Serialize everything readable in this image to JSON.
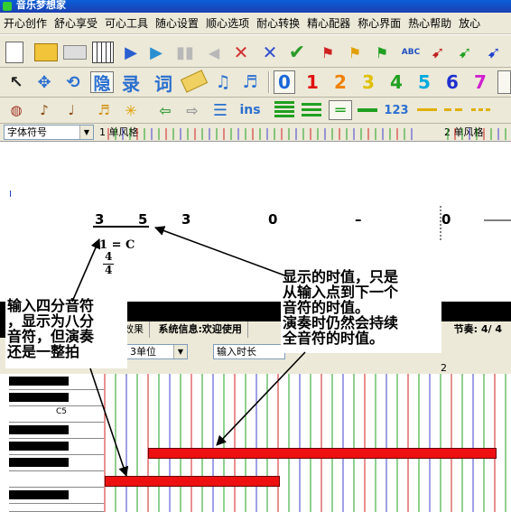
{
  "window": {
    "title": "音乐梦想家"
  },
  "menu": [
    "开心创作",
    "舒心享受",
    "可心工具",
    "随心设置",
    "顺心选项",
    "耐心转换",
    "精心配器",
    "称心界面",
    "热心帮助",
    "放心"
  ],
  "toolbar2": {
    "hide_label": "隐",
    "record_label": "录",
    "lyric_label": "词",
    "numbers": [
      "0",
      "1",
      "2",
      "3",
      "4",
      "5",
      "6",
      "7"
    ],
    "number_colors": [
      "#1a66d8",
      "#e01010",
      "#f08000",
      "#e0c000",
      "#20a020",
      "#00aadd",
      "#2030d0",
      "#d020d0"
    ]
  },
  "toolbar3": {
    "ins_label": "ins",
    "num123_label": "123"
  },
  "selector": {
    "font_combo": "字体符号",
    "staff1_label": "1 单风格",
    "staff2_label": "2 单风格"
  },
  "score": {
    "cursor_mark": "I",
    "notes": [
      "3",
      "5",
      "3",
      "0",
      "–",
      "0"
    ],
    "key": "1 = C",
    "time_num": "4",
    "time_den": "4"
  },
  "status": {
    "layout_effect": "版效果",
    "system_info": "系统信息:欢迎使用",
    "beat": "节奏: 4/ 4"
  },
  "lower": {
    "unit_combo": "3单位",
    "input_combo": "输入时长"
  },
  "roll": {
    "key_label": "C5",
    "measure_2": "2"
  },
  "annotations": {
    "right": [
      "显示的时值，只是",
      "从输入点到下一个",
      "音符的时值。",
      "演奏时仍然会持续",
      "全音符的时值。"
    ],
    "left": [
      "输入四分音符",
      "，显示为八分",
      "音符，但演奏",
      "还是一整拍"
    ]
  },
  "colors": {
    "note_bar": "#ee1010",
    "annotation_arrow": "#000000"
  }
}
